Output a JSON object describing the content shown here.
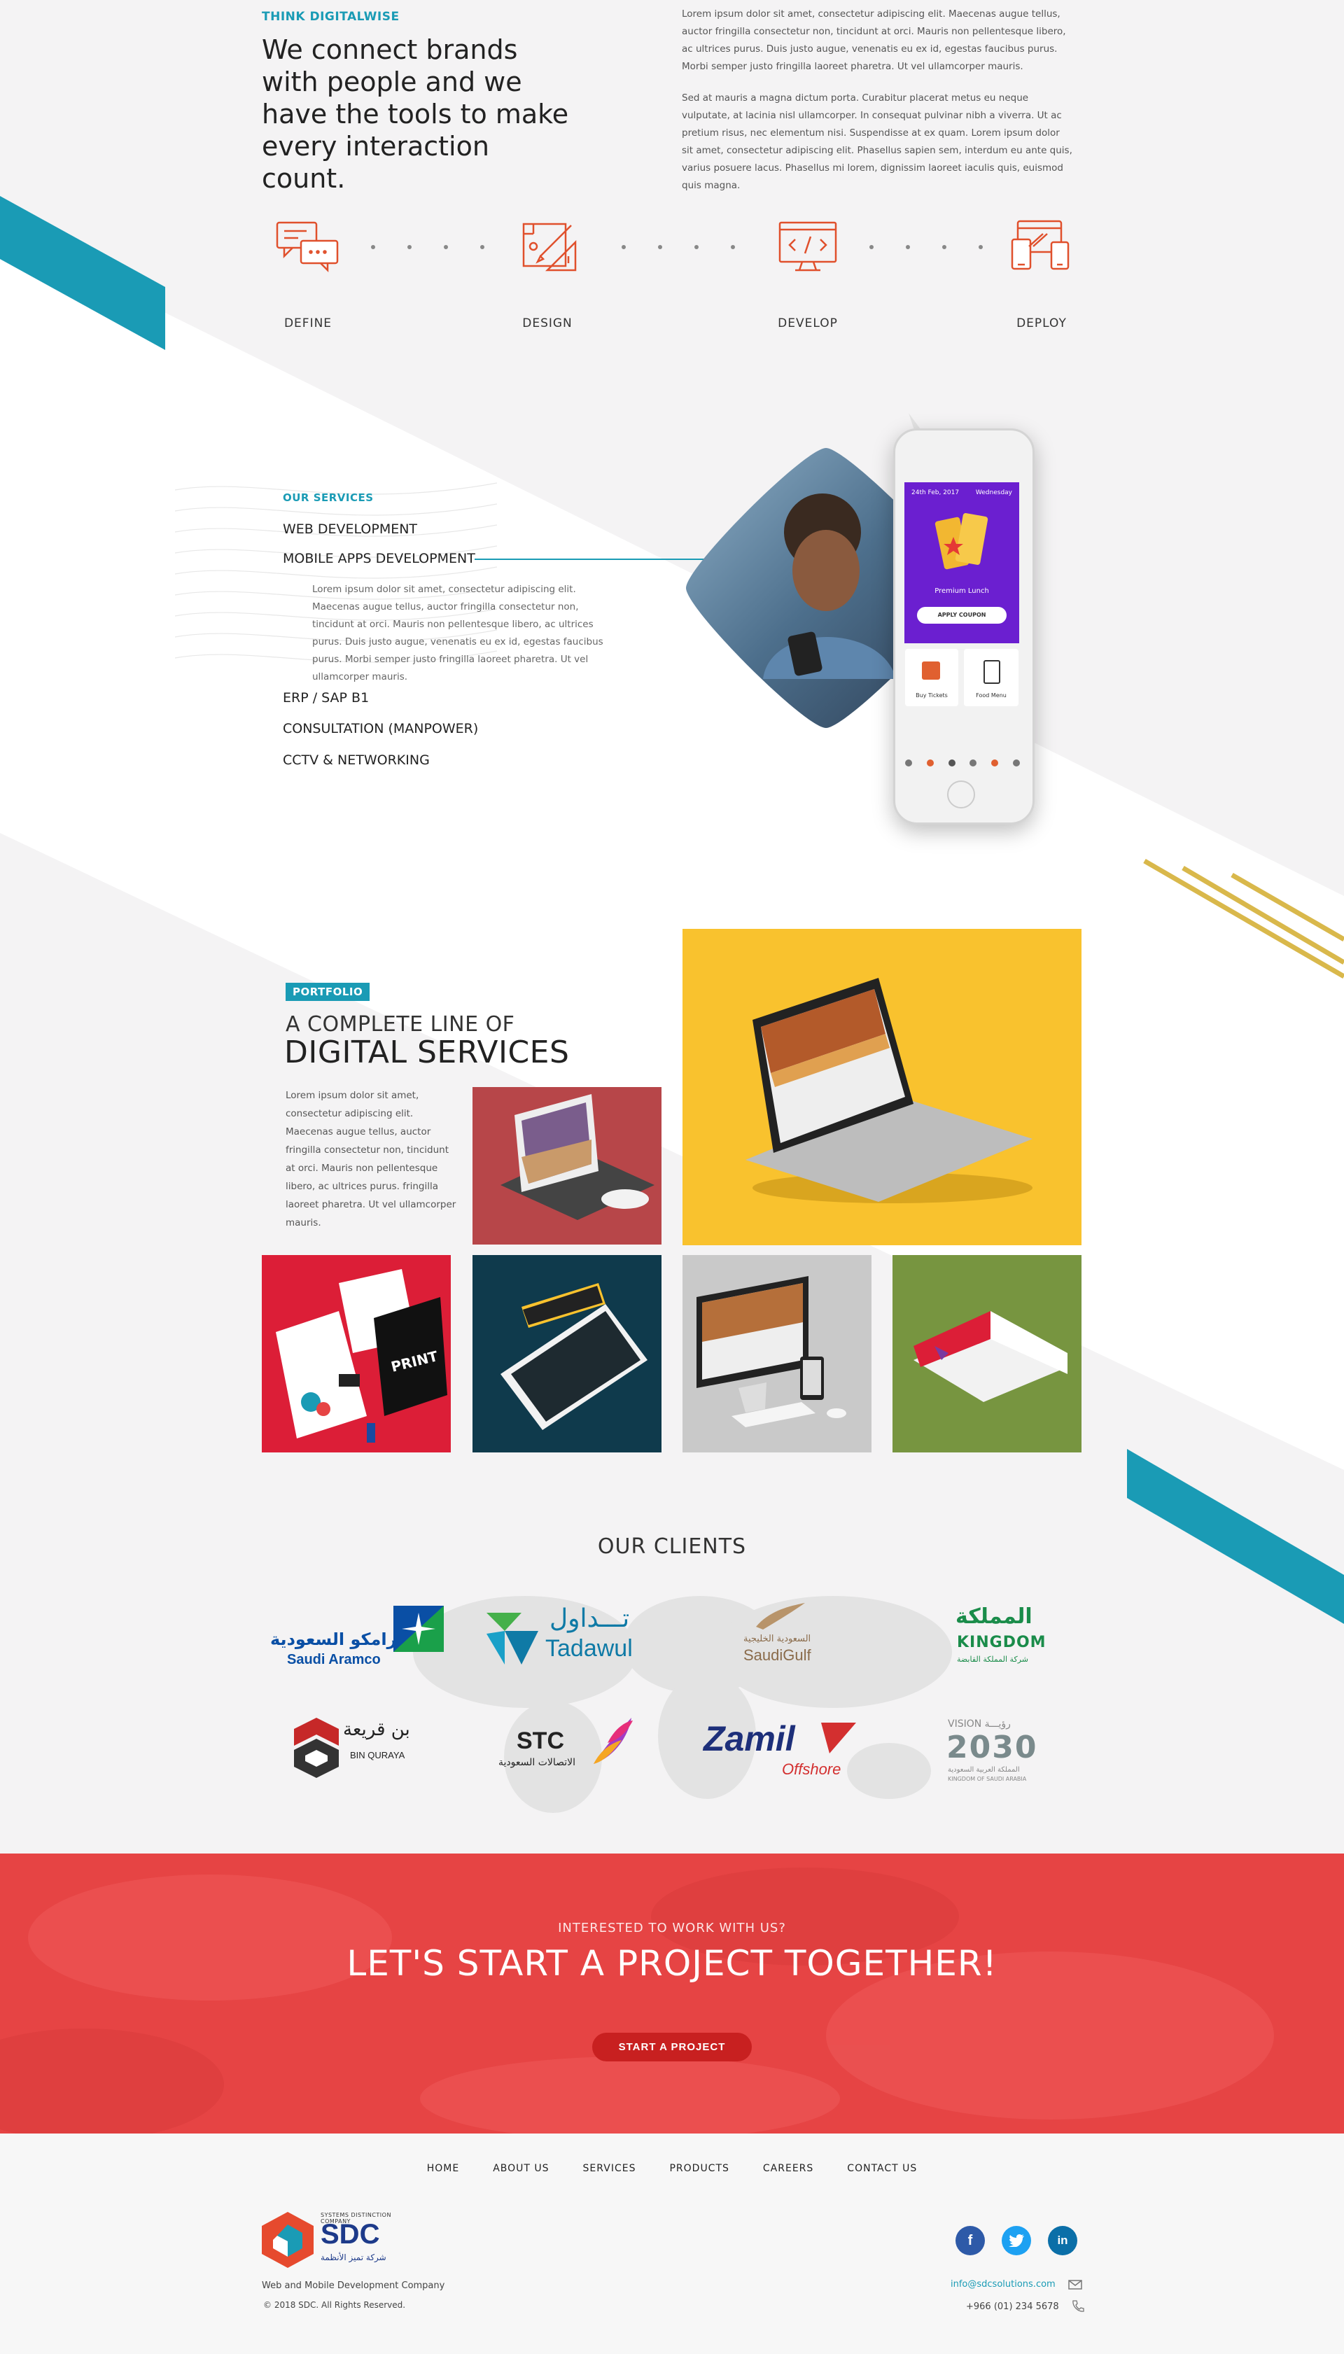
{
  "intro": {
    "eyebrow": "THINK DIGITALWISE",
    "headline": "We connect brands with people and we have the tools to make every interaction count.",
    "para1": "Lorem ipsum dolor sit amet, consectetur adipiscing elit. Maecenas augue tellus, auctor fringilla consectetur non, tincidunt at orci. Mauris non pellentesque libero, ac ultrices purus. Duis justo augue, venenatis eu ex id, egestas faucibus purus. Morbi semper justo fringilla laoreet pharetra. Ut vel ullamcorper mauris.",
    "para2": "Sed at mauris a magna dictum porta. Curabitur placerat metus eu neque vulputate, at lacinia nisl ullamcorper. In consequat pulvinar nibh a viverra. Ut ac pretium risus, nec elementum nisi. Suspendisse at ex quam. Lorem ipsum dolor sit amet, consectetur adipiscing elit. Phasellus sapien sem, interdum eu ante quis, varius posuere lacus. Phasellus mi lorem, dignissim laoreet iaculis quis, euismod quis magna."
  },
  "process": {
    "steps": [
      {
        "label": "DEFINE",
        "icon": "chat-bubbles-icon"
      },
      {
        "label": "DESIGN",
        "icon": "design-tools-icon"
      },
      {
        "label": "DEVELOP",
        "icon": "code-monitor-icon"
      },
      {
        "label": "DEPLOY",
        "icon": "devices-icon"
      }
    ]
  },
  "services": {
    "eyebrow": "OUR SERVICES",
    "items": [
      "WEB DEVELOPMENT",
      "MOBILE APPS DEVELOPMENT",
      "ERP / SAP B1",
      "CONSULTATION (MANPOWER)",
      "CCTV & NETWORKING"
    ],
    "active_desc": "Lorem ipsum dolor sit amet, consectetur adipiscing elit. Maecenas augue tellus, auctor fringilla consectetur non, tincidunt at orci. Mauris non pellentesque libero, ac ultrices purus. Duis justo augue, venenatis eu ex id, egestas faucibus purus. Morbi semper justo fringilla laoreet pharetra. Ut vel ullamcorper mauris.",
    "phone": {
      "date": "24th Feb, 2017",
      "day": "Wednesday",
      "promo": "Premium Lunch",
      "coupon_btn": "APPLY COUPON",
      "card1": "Buy Tickets",
      "card2": "Food Menu"
    }
  },
  "portfolio": {
    "badge": "PORTFOLIO",
    "title_line1": "A COMPLETE LINE OF",
    "title_line2": "DIGITAL SERVICES",
    "desc": "Lorem ipsum dolor sit amet, consectetur adipiscing elit. Maecenas augue tellus, auctor fringilla consectetur non, tincidunt at orci. Mauris non pellentesque libero, ac ultrices purus. fringilla laoreet pharetra. Ut vel ullamcorper mauris.",
    "tiles": [
      {
        "name": "tablet-mockup",
        "bg": "#b74649"
      },
      {
        "name": "laptop-mockup",
        "bg": "#f9c22e"
      },
      {
        "name": "stationery-mockup",
        "bg": "#dc1e37"
      },
      {
        "name": "phone-mockup",
        "bg": "#0f3a4c"
      },
      {
        "name": "desktop-mockup",
        "bg": "#c9c9c9"
      },
      {
        "name": "brochure-mockup",
        "bg": "#779540"
      }
    ],
    "print_text": "PRINT"
  },
  "clients": {
    "title": "OUR CLIENTS",
    "logos": {
      "aramco_ar": "ارامكو السعودية",
      "aramco_en": "Saudi Aramco",
      "tadawul_ar": "تـــداول",
      "tadawul_en": "Tadawul",
      "saudigulf_ar": "السعودية الخليجية",
      "saudigulf_en": "SaudiGulf",
      "kingdom_ar": "المملكة",
      "kingdom_en": "KINGDOM",
      "kingdom_sub": "شركة المملكة القابضة",
      "binquraya_ar": "بن قريعة",
      "binquraya_en": "BIN QURAYA",
      "stc_en": "STC",
      "stc_ar": "الاتصالات السعودية",
      "zamil": "Zamil",
      "zamil_sub": "Offshore",
      "vision_top": "VISION رؤيـــة",
      "vision_year": "2030",
      "vision_ar": "المملكة العربية السعودية",
      "vision_en": "KINGDOM OF SAUDI ARABIA"
    }
  },
  "cta": {
    "kicker": "INTERESTED TO WORK WITH US?",
    "title": "LET'S START A PROJECT TOGETHER!",
    "button": "START A PROJECT"
  },
  "footer": {
    "nav": [
      "HOME",
      "ABOUT US",
      "SERVICES",
      "PRODUCTS",
      "CAREERS",
      "CONTACT US"
    ],
    "brand_top": "SYSTEMS DISTINCTION COMPANY",
    "brand": "SDC",
    "brand_ar": "شركة تميز الأنظمة",
    "tagline": "Web and Mobile Development Company",
    "copyright": "© 2018 SDC. All Rights Reserved.",
    "email": "info@sdcsolutions.com",
    "phone": "+966 (01) 234 5678",
    "social": [
      "facebook-icon",
      "twitter-icon",
      "linkedin-icon"
    ]
  },
  "colors": {
    "accent": "#1a9bb5",
    "orange": "#e0502c",
    "cta_red": "#e64444",
    "gold": "#d9b84b"
  }
}
